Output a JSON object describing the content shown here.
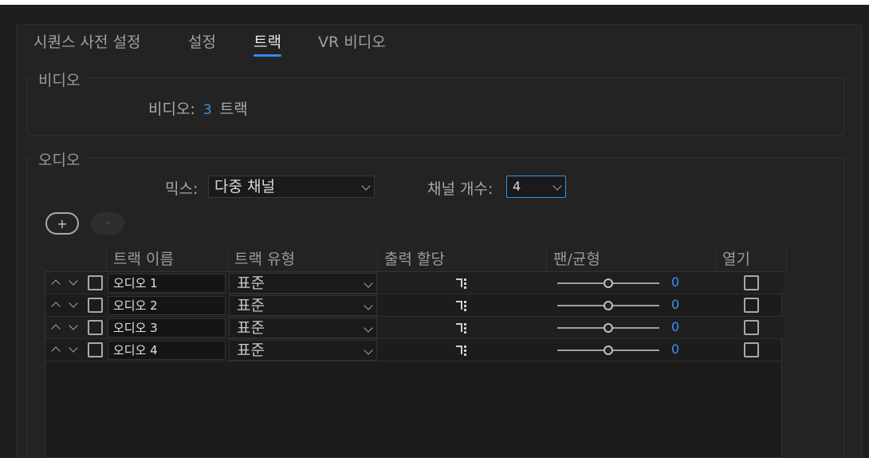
{
  "tabs": [
    {
      "label": "시퀀스 사전 설정",
      "active": false
    },
    {
      "label": "설정",
      "active": false
    },
    {
      "label": "트랙",
      "active": true
    },
    {
      "label": "VR 비디오",
      "active": false
    }
  ],
  "video": {
    "group_label": "비디오",
    "label": "비디오:",
    "count": "3",
    "unit": "트랙"
  },
  "audio": {
    "group_label": "오디오",
    "mix_label": "믹스:",
    "mix_value": "다중 채널",
    "channel_label": "채널 개수:",
    "channel_value": "4",
    "add_label": "+",
    "remove_label": "-"
  },
  "table": {
    "headers": [
      "트랙 이름",
      "트랙 유형",
      "출력 할당",
      "팬/균형",
      "열기"
    ],
    "rows": [
      {
        "name": "오디오 1",
        "type": "표준",
        "pan": "0"
      },
      {
        "name": "오디오 2",
        "type": "표준",
        "pan": "0"
      },
      {
        "name": "오디오 3",
        "type": "표준",
        "pan": "0"
      },
      {
        "name": "오디오 4",
        "type": "표준",
        "pan": "0"
      }
    ]
  },
  "colors": {
    "accent": "#2d8ceb",
    "value_blue": "#3b93f0",
    "background": "#232323"
  },
  "icons": {
    "move_up": "chevron-up-icon",
    "move_down": "chevron-down-icon",
    "output": "routing-icon"
  }
}
